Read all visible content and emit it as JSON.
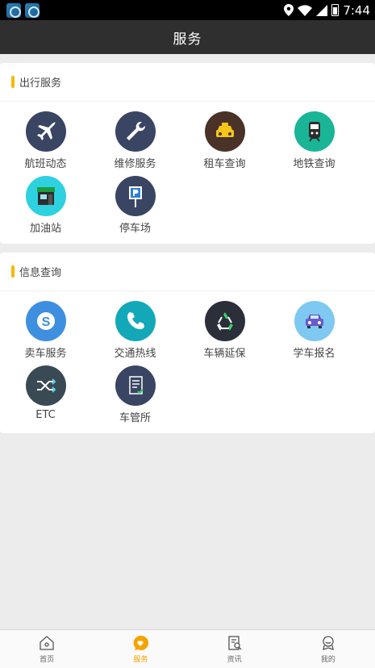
{
  "status_bar": {
    "time": "7:44"
  },
  "header": {
    "title": "服务"
  },
  "sections": [
    {
      "title": "出行服务",
      "items": [
        {
          "label": "航班动态",
          "icon": "airplane-icon",
          "color": "#3a4563"
        },
        {
          "label": "维修服务",
          "icon": "wrench-icon",
          "color": "#3a4563"
        },
        {
          "label": "租车查询",
          "icon": "taxi-icon",
          "color": "#4a3228"
        },
        {
          "label": "地铁查询",
          "icon": "subway-icon",
          "color": "#19b596"
        },
        {
          "label": "加油站",
          "icon": "gas-station-icon",
          "color": "#2ed1e0"
        },
        {
          "label": "停车场",
          "icon": "parking-icon",
          "color": "#3a4563"
        }
      ]
    },
    {
      "title": "信息查询",
      "items": [
        {
          "label": "卖车服务",
          "icon": "skype-icon",
          "color": "#3e8fe0"
        },
        {
          "label": "交通热线",
          "icon": "phone-icon",
          "color": "#12a8b8"
        },
        {
          "label": "车辆延保",
          "icon": "recycle-icon",
          "color": "#2b2f3a"
        },
        {
          "label": "学车报名",
          "icon": "car-icon",
          "color": "#7ec8f2"
        },
        {
          "label": "ETC",
          "icon": "shuffle-icon",
          "color": "#3a4a55"
        },
        {
          "label": "车管所",
          "icon": "document-icon",
          "color": "#3a4563"
        }
      ]
    }
  ],
  "tabs": [
    {
      "label": "首页",
      "icon": "home-icon",
      "active": false
    },
    {
      "label": "服务",
      "icon": "service-icon",
      "active": true
    },
    {
      "label": "资讯",
      "icon": "news-icon",
      "active": false
    },
    {
      "label": "我的",
      "icon": "profile-icon",
      "active": false
    }
  ],
  "colors": {
    "accent": "#f5b800",
    "active_tab": "#f5a300",
    "header_bg": "#2f2f2f"
  }
}
